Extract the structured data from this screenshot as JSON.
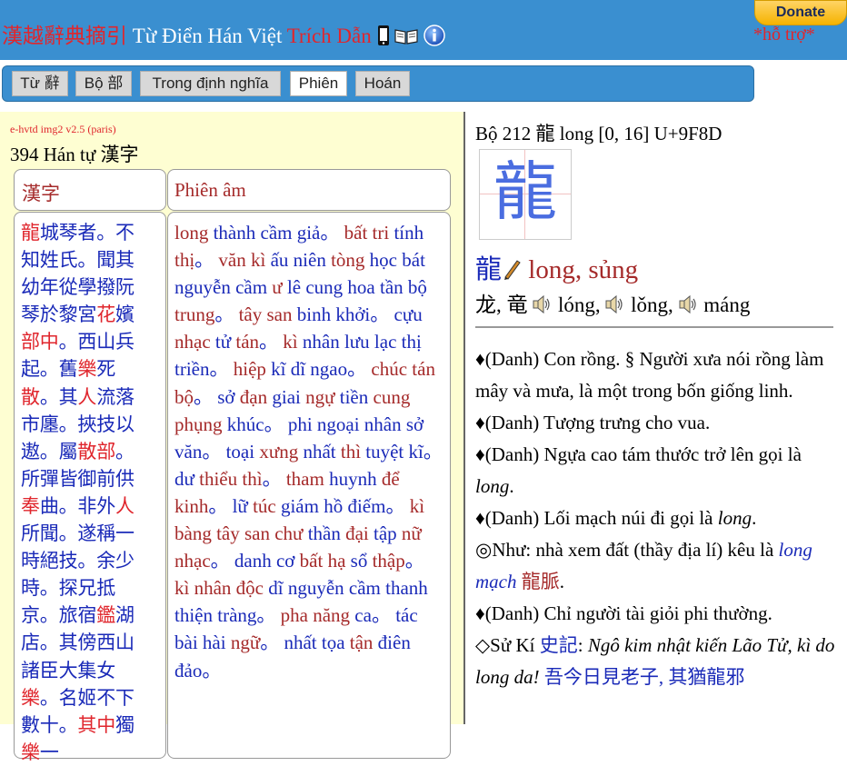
{
  "header": {
    "title_han": "漢越辭典摘引",
    "title_viet": "Từ Điển Hán Việt",
    "title_trich": "Trích Dẫn",
    "icons": [
      "mobile-icon",
      "book-icon",
      "info-icon"
    ],
    "donate_label": "Donate",
    "support_label": "*hỗ trợ*"
  },
  "tabs": [
    {
      "label": "Từ 辭",
      "active": false
    },
    {
      "label": "Bộ 部",
      "active": false
    },
    {
      "label": "Trong định nghĩa",
      "active": false
    },
    {
      "label": "Phiên",
      "active": true
    },
    {
      "label": "Hoán",
      "active": false
    }
  ],
  "left": {
    "version": "e-hvtd img2 v2.5 (paris)",
    "count": "394 Hán tự 漢字",
    "col_han": "漢字",
    "col_phien": "Phiên âm"
  },
  "right": {
    "entry_head": "Bộ 212 龍 long [0, 16] U+9F8D",
    "glyph": "龍",
    "reading_char": "龍",
    "reading": "long, sủng",
    "variants": [
      {
        "text": "龙, 竜 "
      },
      {
        "text": "lóng, "
      },
      {
        "text": "lǒng, "
      },
      {
        "text": "máng"
      }
    ]
  },
  "colors": {
    "header_bg": "#3a8fd0",
    "left_bg": "#fefed2",
    "link_blue": "#1a2ab8",
    "link_red": "#e0262d"
  }
}
